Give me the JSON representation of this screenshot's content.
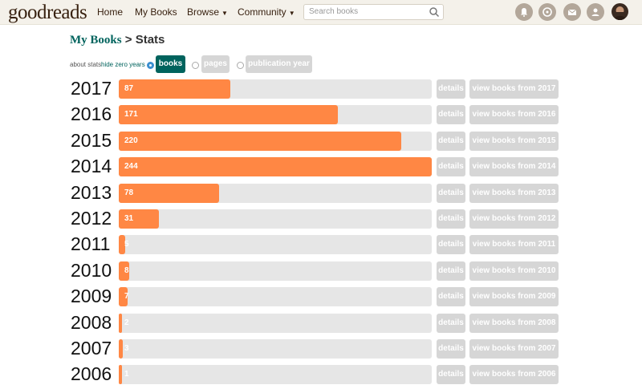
{
  "header": {
    "logo_bold": "good",
    "logo_light": "reads",
    "nav": [
      {
        "label": "Home",
        "caret": false
      },
      {
        "label": "My Books",
        "caret": false
      },
      {
        "label": "Browse",
        "caret": true
      },
      {
        "label": "Community",
        "caret": true
      }
    ],
    "search_placeholder": "Search books",
    "icons": [
      "bell-icon",
      "chat-icon",
      "mail-icon",
      "friends-icon"
    ]
  },
  "title": {
    "link": "My Books",
    "sep": ">",
    "text": "Stats"
  },
  "controls": {
    "about": "about stats",
    "hide_zero": "hide zero years",
    "options": [
      {
        "label": "books",
        "selected": true
      },
      {
        "label": "pages",
        "selected": false
      },
      {
        "label": "publication year",
        "selected": false
      }
    ]
  },
  "details_label": "details",
  "max_count": 244,
  "accent_color": "#ff8744",
  "rows": [
    {
      "year": "2017",
      "count": 87,
      "view": "view books from 2017"
    },
    {
      "year": "2016",
      "count": 171,
      "view": "view books from 2016"
    },
    {
      "year": "2015",
      "count": 220,
      "view": "view books from 2015"
    },
    {
      "year": "2014",
      "count": 244,
      "view": "view books from 2014"
    },
    {
      "year": "2013",
      "count": 78,
      "view": "view books from 2013"
    },
    {
      "year": "2012",
      "count": 31,
      "view": "view books from 2012"
    },
    {
      "year": "2011",
      "count": 5,
      "view": "view books from 2011"
    },
    {
      "year": "2010",
      "count": 8,
      "view": "view books from 2010"
    },
    {
      "year": "2009",
      "count": 7,
      "view": "view books from 2009"
    },
    {
      "year": "2008",
      "count": 2,
      "view": "view books from 2008"
    },
    {
      "year": "2007",
      "count": 3,
      "view": "view books from 2007"
    },
    {
      "year": "2006",
      "count": 1,
      "view": "view books from 2006"
    }
  ]
}
